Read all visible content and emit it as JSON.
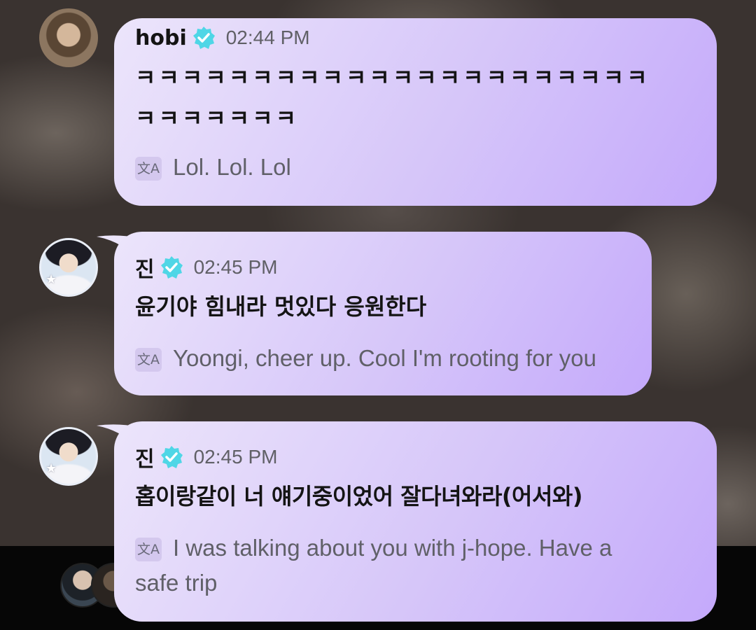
{
  "messages": [
    {
      "sender": "hobi",
      "time": "02:44 PM",
      "verified": true,
      "avatar_icon": "hobi-avatar",
      "text_line1": "ㅋㅋㅋㅋㅋㅋㅋㅋㅋㅋㅋㅋㅋㅋㅋㅋㅋㅋㅋㅋㅋㅋ",
      "text_line2": "ㅋㅋㅋㅋㅋㅋㅋ",
      "translation": "Lol. Lol. Lol"
    },
    {
      "sender": "진",
      "time": "02:45 PM",
      "verified": true,
      "avatar_icon": "jin-avatar",
      "text": "윤기야 힘내라 멋있다 응원한다",
      "translation": "Yoongi, cheer up. Cool I'm rooting for you"
    },
    {
      "sender": "진",
      "time": "02:45 PM",
      "verified": true,
      "avatar_icon": "jin-avatar",
      "text": "홉이랑같이 너 얘기중이었어 잘다녀와라(어서와)",
      "translation_line1": "I was talking about you with j-hope. Have a",
      "translation_line2": "safe trip"
    }
  ],
  "icons": {
    "verified": "verified-badge-icon",
    "translate": "translate-icon",
    "translate_glyph": "文A"
  },
  "colors": {
    "bubble_start": "#ece5fb",
    "bubble_end": "#c4a9fb",
    "verified": "#4fd6e6",
    "name": "#141414",
    "time": "#606066"
  }
}
